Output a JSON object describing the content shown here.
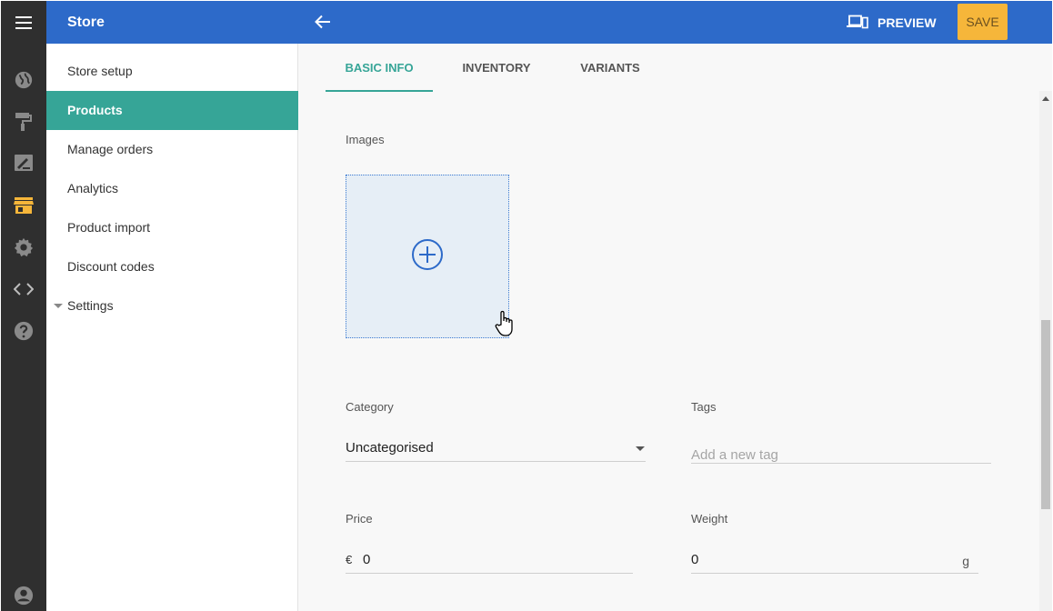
{
  "header": {
    "title": "Store",
    "preview_label": "PREVIEW",
    "save_label": "SAVE"
  },
  "rail": {
    "icons": [
      "menu-icon",
      "globe-icon",
      "paint-roller-icon",
      "edit-icon",
      "store-icon",
      "gear-icon",
      "code-icon",
      "help-icon",
      "account-icon"
    ],
    "active_icon": "store-icon",
    "active_color": "#f6b63a"
  },
  "sidebar": {
    "items": [
      {
        "label": "Store setup"
      },
      {
        "label": "Products",
        "active": true
      },
      {
        "label": "Manage orders"
      },
      {
        "label": "Analytics"
      },
      {
        "label": "Product import"
      },
      {
        "label": "Discount codes"
      },
      {
        "label": "Settings",
        "collapsible": true
      }
    ]
  },
  "tabs": [
    {
      "label": "BASIC INFO",
      "active": true
    },
    {
      "label": "INVENTORY"
    },
    {
      "label": "VARIANTS"
    }
  ],
  "form": {
    "images_label": "Images",
    "category": {
      "label": "Category",
      "value": "Uncategorised"
    },
    "tags": {
      "label": "Tags",
      "placeholder": "Add a new tag"
    },
    "price": {
      "label": "Price",
      "prefix": "€",
      "value": "0"
    },
    "weight": {
      "label": "Weight",
      "value": "0",
      "unit": "g"
    }
  },
  "colors": {
    "topbar": "#2d6ac9",
    "accent": "#36a597",
    "save": "#f6b63a",
    "rail": "#2f2f2f"
  }
}
